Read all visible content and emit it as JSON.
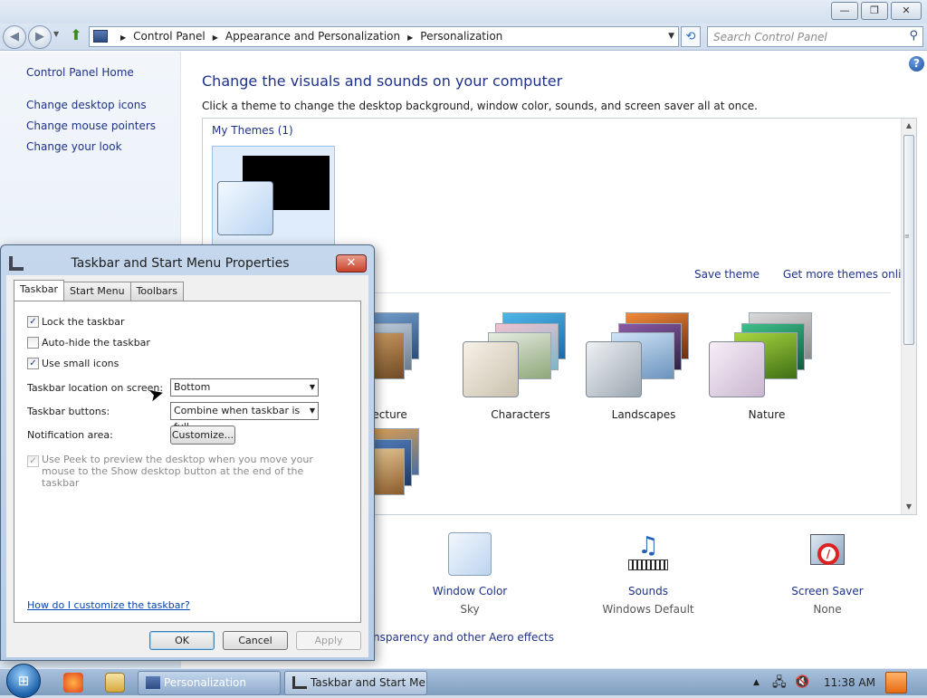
{
  "window": {
    "caption_buttons": {
      "minimize": "—",
      "restore": "❐",
      "close": "✕"
    }
  },
  "navbar": {
    "back_icon": "back-arrow-icon",
    "forward_icon": "forward-arrow-icon",
    "breadcrumbs": [
      "Control Panel",
      "Appearance and Personalization",
      "Personalization"
    ],
    "search_placeholder": "Search Control Panel"
  },
  "sidebar": {
    "home": "Control Panel Home",
    "links": [
      "Change desktop icons",
      "Change mouse pointers",
      "Change your look"
    ]
  },
  "main": {
    "title": "Change the visuals and sounds on your computer",
    "subtitle": "Click a theme to change the desktop background, window color, sounds, and screen saver all at once.",
    "my_themes": "My Themes (1)",
    "save_theme": "Save theme",
    "get_more": "Get more themes online",
    "themes": [
      {
        "label": "Architecture"
      },
      {
        "label": "Characters"
      },
      {
        "label": "Landscapes"
      },
      {
        "label": "Nature"
      }
    ],
    "bottom": {
      "window_color": {
        "title": "Window Color",
        "value": "Sky"
      },
      "sounds": {
        "title": "Sounds",
        "value": "Windows Default"
      },
      "screen_saver": {
        "title": "Screen Saver",
        "value": "None"
      }
    },
    "aero_link": "nsparency and other Aero effects"
  },
  "dialog": {
    "title": "Taskbar and Start Menu Properties",
    "tabs": [
      "Taskbar",
      "Start Menu",
      "Toolbars"
    ],
    "lock": {
      "label": "Lock the taskbar",
      "checked": true
    },
    "autohide": {
      "label": "Auto-hide the taskbar",
      "checked": false
    },
    "small_icons": {
      "label": "Use small icons",
      "checked": true
    },
    "location_label": "Taskbar location on screen:",
    "location_value": "Bottom",
    "buttons_label": "Taskbar buttons:",
    "buttons_value": "Combine when taskbar is full",
    "notification_label": "Notification area:",
    "customize": "Customize...",
    "peek_text": "Use Peek to preview the desktop when you move your mouse to the Show desktop button at the end of the taskbar",
    "how_to": "How do I customize the taskbar?",
    "ok": "OK",
    "cancel": "Cancel",
    "apply": "Apply"
  },
  "taskbar": {
    "buttons": [
      "Personalization",
      "Taskbar and Start Me..."
    ],
    "time": "11:38 AM"
  }
}
